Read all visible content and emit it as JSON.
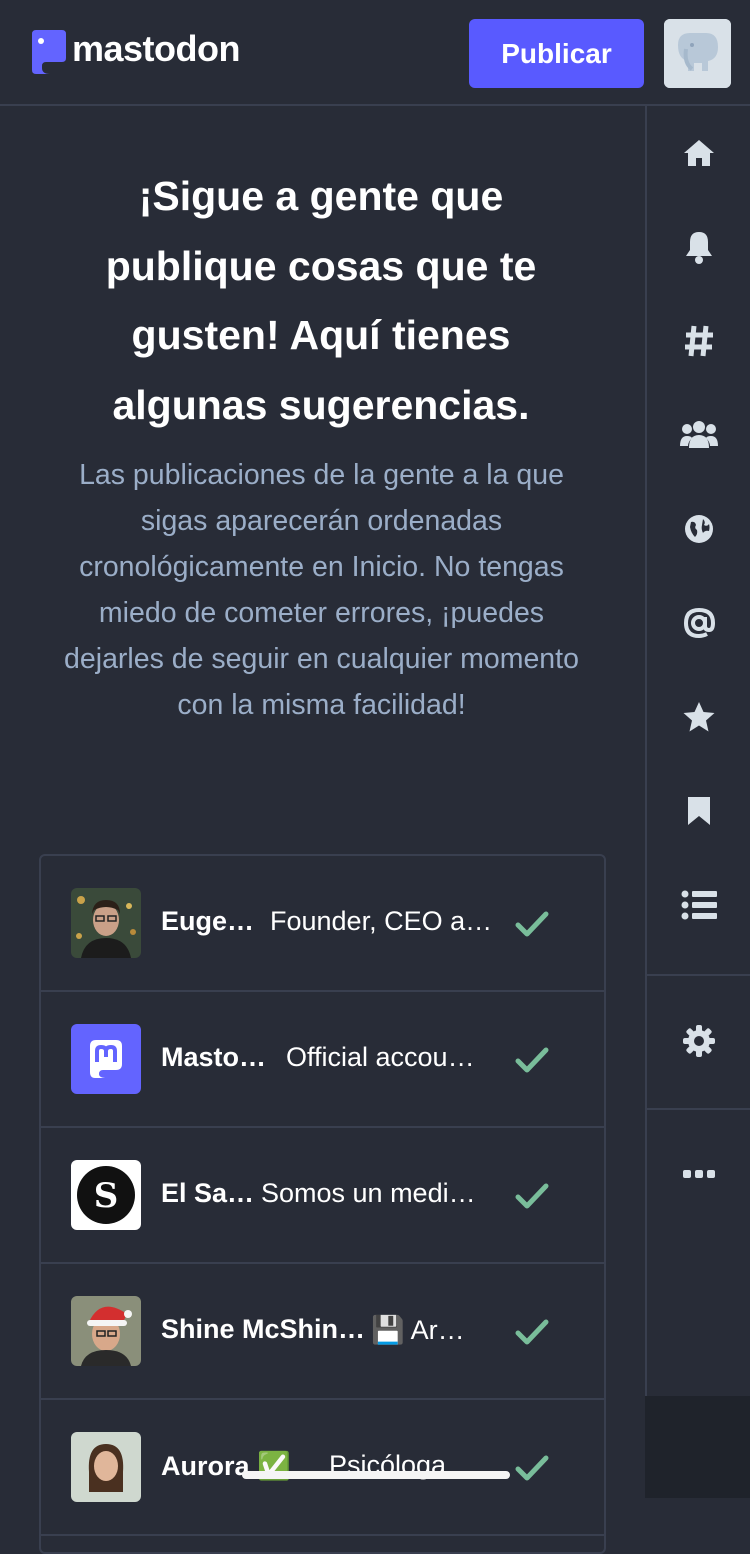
{
  "header": {
    "logo_text": "mastodon",
    "publish_label": "Publicar"
  },
  "onboarding": {
    "title": "¡Sigue a gente que publique cosas que te gusten! Aquí tienes algunas sugerencias.",
    "description": "Las publicaciones de la gente a la que sigas aparecerán ordenadas cronológicamente en Inicio. No tengas miedo de cometer errores, ¡puedes dejarles de seguir en cualquier momento con la misma facilidad!"
  },
  "sidebar": {
    "items": [
      {
        "icon": "home-icon"
      },
      {
        "icon": "bell-icon"
      },
      {
        "icon": "hashtag-icon"
      },
      {
        "icon": "users-icon"
      },
      {
        "icon": "globe-icon"
      },
      {
        "icon": "at-icon"
      },
      {
        "icon": "star-icon"
      },
      {
        "icon": "bookmark-icon"
      },
      {
        "icon": "list-icon"
      },
      {
        "icon": "gear-icon"
      },
      {
        "icon": "ellipsis-icon"
      }
    ]
  },
  "suggestions": [
    {
      "name": "Euge…",
      "bio": "Founder, CEO a…",
      "followed": true
    },
    {
      "name": "Masto…",
      "bio": "Official accou…",
      "followed": true
    },
    {
      "name": "El Sa…",
      "bio": "Somos un medi…",
      "followed": true
    },
    {
      "name": "Shine McShin…",
      "bio": "💾 Ar…",
      "followed": true
    },
    {
      "name": "Aurora ✅",
      "bio": "Psicóloga",
      "followed": true
    }
  ],
  "colors": {
    "background": "#282c37",
    "accent": "#595aff",
    "secondary_text": "#9baec8",
    "check": "#79bd9a",
    "icon": "#d9e1e8"
  }
}
